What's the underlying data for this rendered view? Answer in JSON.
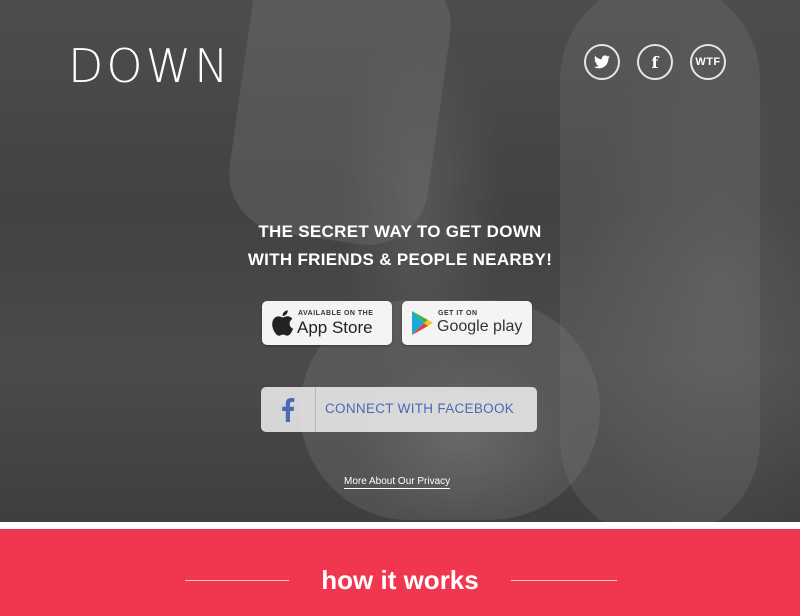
{
  "brand": {
    "logo": "DOWN"
  },
  "social": {
    "twitter_icon": "twitter-bird-icon",
    "facebook_label": "f",
    "wtf_label": "WTF"
  },
  "hero": {
    "tagline_line1": "THE SECRET WAY TO GET DOWN",
    "tagline_line2": "WITH FRIENDS & PEOPLE NEARBY!"
  },
  "app_store": {
    "small": "AVAILABLE ON THE",
    "big": "App Store",
    "icon": "apple-icon"
  },
  "google_play": {
    "small": "GET IT ON",
    "big": "Google play",
    "icon": "google-play-icon"
  },
  "facebook_connect": {
    "label": "CONNECT WITH FACEBOOK",
    "icon": "facebook-icon"
  },
  "privacy_link": "More About Our Privacy",
  "how_it_works": {
    "title": "how it works"
  },
  "colors": {
    "accent": "#f1364f",
    "facebook_blue": "#4b69b4",
    "white": "#ffffff"
  }
}
